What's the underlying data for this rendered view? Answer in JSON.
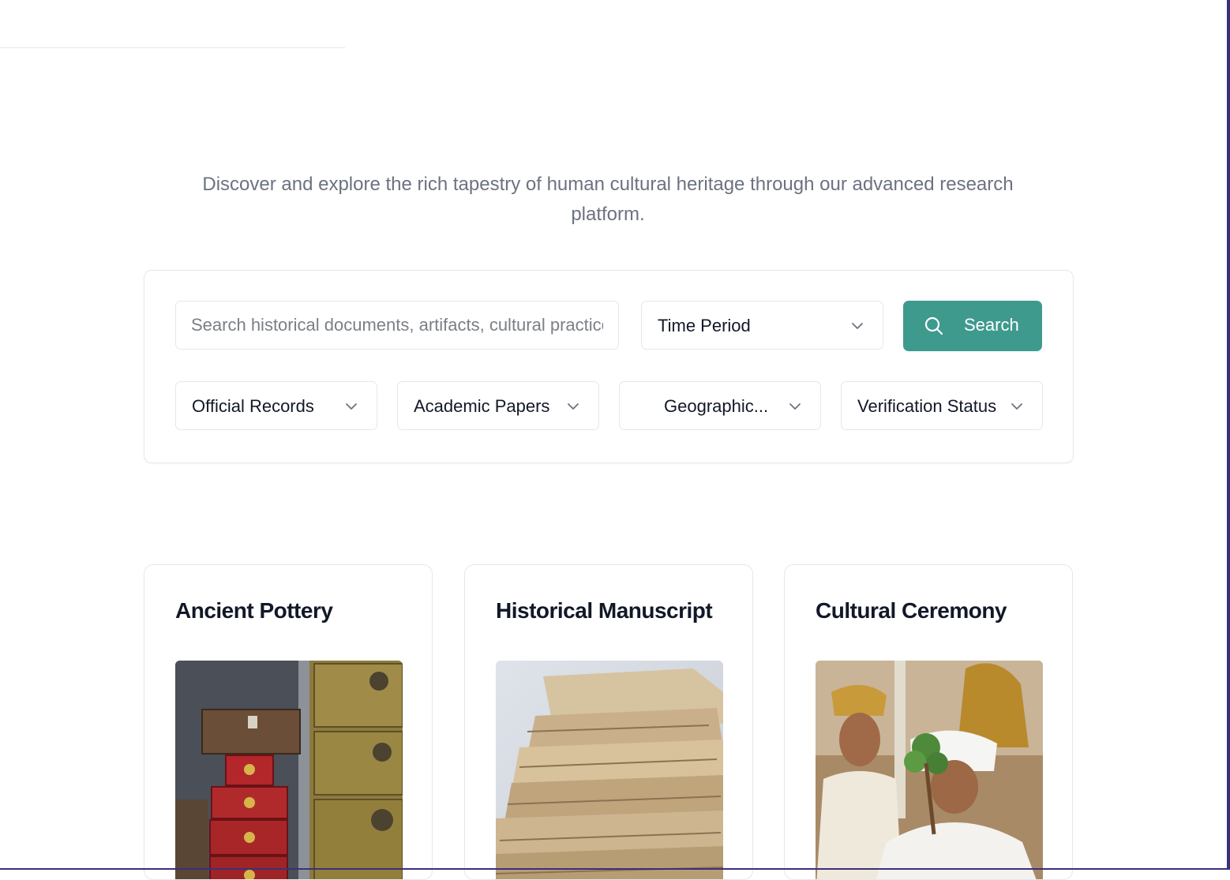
{
  "hero": {
    "intro": "Discover and explore the rich tapestry of human cultural heritage through our advanced research platform."
  },
  "search": {
    "placeholder": "Search historical documents, artifacts, cultural practices...",
    "time_period_label": "Time Period",
    "button_label": "Search",
    "filters": [
      {
        "label": "Official Records"
      },
      {
        "label": "Academic Papers"
      },
      {
        "label": "Geographic..."
      },
      {
        "label": "Verification Status"
      }
    ]
  },
  "cards": [
    {
      "title": "Ancient Pottery",
      "image": "stacked-chests-photo"
    },
    {
      "title": "Historical Manuscript",
      "image": "paper-stack-photo"
    },
    {
      "title": "Cultural Ceremony",
      "image": "ceremony-photo"
    }
  ],
  "colors": {
    "accent": "#3f9a8e",
    "muted_text": "#6b7280",
    "border": "#e5e7eb",
    "frame": "#3d2f7a"
  },
  "icons": {
    "search": "search-icon",
    "dropdown": "chevron-down-icon"
  }
}
